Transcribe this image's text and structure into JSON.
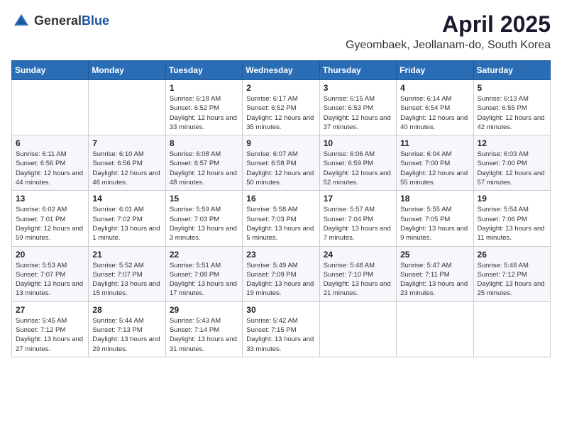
{
  "logo": {
    "general": "General",
    "blue": "Blue"
  },
  "title": "April 2025",
  "location": "Gyeombaek, Jeollanam-do, South Korea",
  "days_of_week": [
    "Sunday",
    "Monday",
    "Tuesday",
    "Wednesday",
    "Thursday",
    "Friday",
    "Saturday"
  ],
  "weeks": [
    [
      {
        "day": "",
        "detail": ""
      },
      {
        "day": "",
        "detail": ""
      },
      {
        "day": "1",
        "detail": "Sunrise: 6:18 AM\nSunset: 6:52 PM\nDaylight: 12 hours and 33 minutes."
      },
      {
        "day": "2",
        "detail": "Sunrise: 6:17 AM\nSunset: 6:52 PM\nDaylight: 12 hours and 35 minutes."
      },
      {
        "day": "3",
        "detail": "Sunrise: 6:15 AM\nSunset: 6:53 PM\nDaylight: 12 hours and 37 minutes."
      },
      {
        "day": "4",
        "detail": "Sunrise: 6:14 AM\nSunset: 6:54 PM\nDaylight: 12 hours and 40 minutes."
      },
      {
        "day": "5",
        "detail": "Sunrise: 6:13 AM\nSunset: 6:55 PM\nDaylight: 12 hours and 42 minutes."
      }
    ],
    [
      {
        "day": "6",
        "detail": "Sunrise: 6:11 AM\nSunset: 6:56 PM\nDaylight: 12 hours and 44 minutes."
      },
      {
        "day": "7",
        "detail": "Sunrise: 6:10 AM\nSunset: 6:56 PM\nDaylight: 12 hours and 46 minutes."
      },
      {
        "day": "8",
        "detail": "Sunrise: 6:08 AM\nSunset: 6:57 PM\nDaylight: 12 hours and 48 minutes."
      },
      {
        "day": "9",
        "detail": "Sunrise: 6:07 AM\nSunset: 6:58 PM\nDaylight: 12 hours and 50 minutes."
      },
      {
        "day": "10",
        "detail": "Sunrise: 6:06 AM\nSunset: 6:59 PM\nDaylight: 12 hours and 52 minutes."
      },
      {
        "day": "11",
        "detail": "Sunrise: 6:04 AM\nSunset: 7:00 PM\nDaylight: 12 hours and 55 minutes."
      },
      {
        "day": "12",
        "detail": "Sunrise: 6:03 AM\nSunset: 7:00 PM\nDaylight: 12 hours and 57 minutes."
      }
    ],
    [
      {
        "day": "13",
        "detail": "Sunrise: 6:02 AM\nSunset: 7:01 PM\nDaylight: 12 hours and 59 minutes."
      },
      {
        "day": "14",
        "detail": "Sunrise: 6:01 AM\nSunset: 7:02 PM\nDaylight: 13 hours and 1 minute."
      },
      {
        "day": "15",
        "detail": "Sunrise: 5:59 AM\nSunset: 7:03 PM\nDaylight: 13 hours and 3 minutes."
      },
      {
        "day": "16",
        "detail": "Sunrise: 5:58 AM\nSunset: 7:03 PM\nDaylight: 13 hours and 5 minutes."
      },
      {
        "day": "17",
        "detail": "Sunrise: 5:57 AM\nSunset: 7:04 PM\nDaylight: 13 hours and 7 minutes."
      },
      {
        "day": "18",
        "detail": "Sunrise: 5:55 AM\nSunset: 7:05 PM\nDaylight: 13 hours and 9 minutes."
      },
      {
        "day": "19",
        "detail": "Sunrise: 5:54 AM\nSunset: 7:06 PM\nDaylight: 13 hours and 11 minutes."
      }
    ],
    [
      {
        "day": "20",
        "detail": "Sunrise: 5:53 AM\nSunset: 7:07 PM\nDaylight: 13 hours and 13 minutes."
      },
      {
        "day": "21",
        "detail": "Sunrise: 5:52 AM\nSunset: 7:07 PM\nDaylight: 13 hours and 15 minutes."
      },
      {
        "day": "22",
        "detail": "Sunrise: 5:51 AM\nSunset: 7:08 PM\nDaylight: 13 hours and 17 minutes."
      },
      {
        "day": "23",
        "detail": "Sunrise: 5:49 AM\nSunset: 7:09 PM\nDaylight: 13 hours and 19 minutes."
      },
      {
        "day": "24",
        "detail": "Sunrise: 5:48 AM\nSunset: 7:10 PM\nDaylight: 13 hours and 21 minutes."
      },
      {
        "day": "25",
        "detail": "Sunrise: 5:47 AM\nSunset: 7:11 PM\nDaylight: 13 hours and 23 minutes."
      },
      {
        "day": "26",
        "detail": "Sunrise: 5:46 AM\nSunset: 7:12 PM\nDaylight: 13 hours and 25 minutes."
      }
    ],
    [
      {
        "day": "27",
        "detail": "Sunrise: 5:45 AM\nSunset: 7:12 PM\nDaylight: 13 hours and 27 minutes."
      },
      {
        "day": "28",
        "detail": "Sunrise: 5:44 AM\nSunset: 7:13 PM\nDaylight: 13 hours and 29 minutes."
      },
      {
        "day": "29",
        "detail": "Sunrise: 5:43 AM\nSunset: 7:14 PM\nDaylight: 13 hours and 31 minutes."
      },
      {
        "day": "30",
        "detail": "Sunrise: 5:42 AM\nSunset: 7:15 PM\nDaylight: 13 hours and 33 minutes."
      },
      {
        "day": "",
        "detail": ""
      },
      {
        "day": "",
        "detail": ""
      },
      {
        "day": "",
        "detail": ""
      }
    ]
  ]
}
